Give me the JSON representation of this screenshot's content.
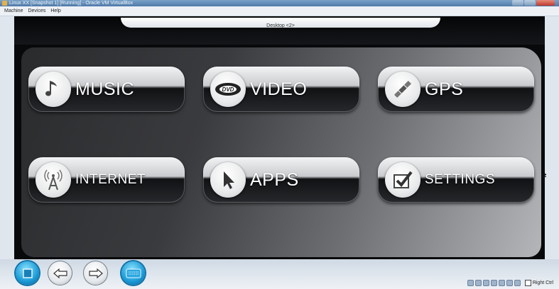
{
  "window": {
    "title": "Linux XX [Snapshot 1] [Running] - Oracle VM VirtualBox"
  },
  "menu": {
    "items": [
      "Machine",
      "Devices",
      "Help"
    ]
  },
  "desktop": {
    "label": "Desktop <2>"
  },
  "launcher": {
    "tiles": [
      {
        "label": "MUSIC",
        "icon": "music-note-icon"
      },
      {
        "label": "VIDEO",
        "icon": "dvd-icon"
      },
      {
        "label": "GPS",
        "icon": "satellite-icon"
      },
      {
        "label": "INTERNET",
        "icon": "antenna-icon"
      },
      {
        "label": "APPS",
        "icon": "cursor-arrow-icon"
      },
      {
        "label": "SETTINGS",
        "icon": "checkbox-icon"
      }
    ]
  },
  "taskbar": {
    "buttons": [
      "home-icon",
      "back-arrow-icon",
      "forward-arrow-icon",
      "keyboard-icon"
    ]
  },
  "statusbar": {
    "host_key": "Right Ctrl"
  }
}
